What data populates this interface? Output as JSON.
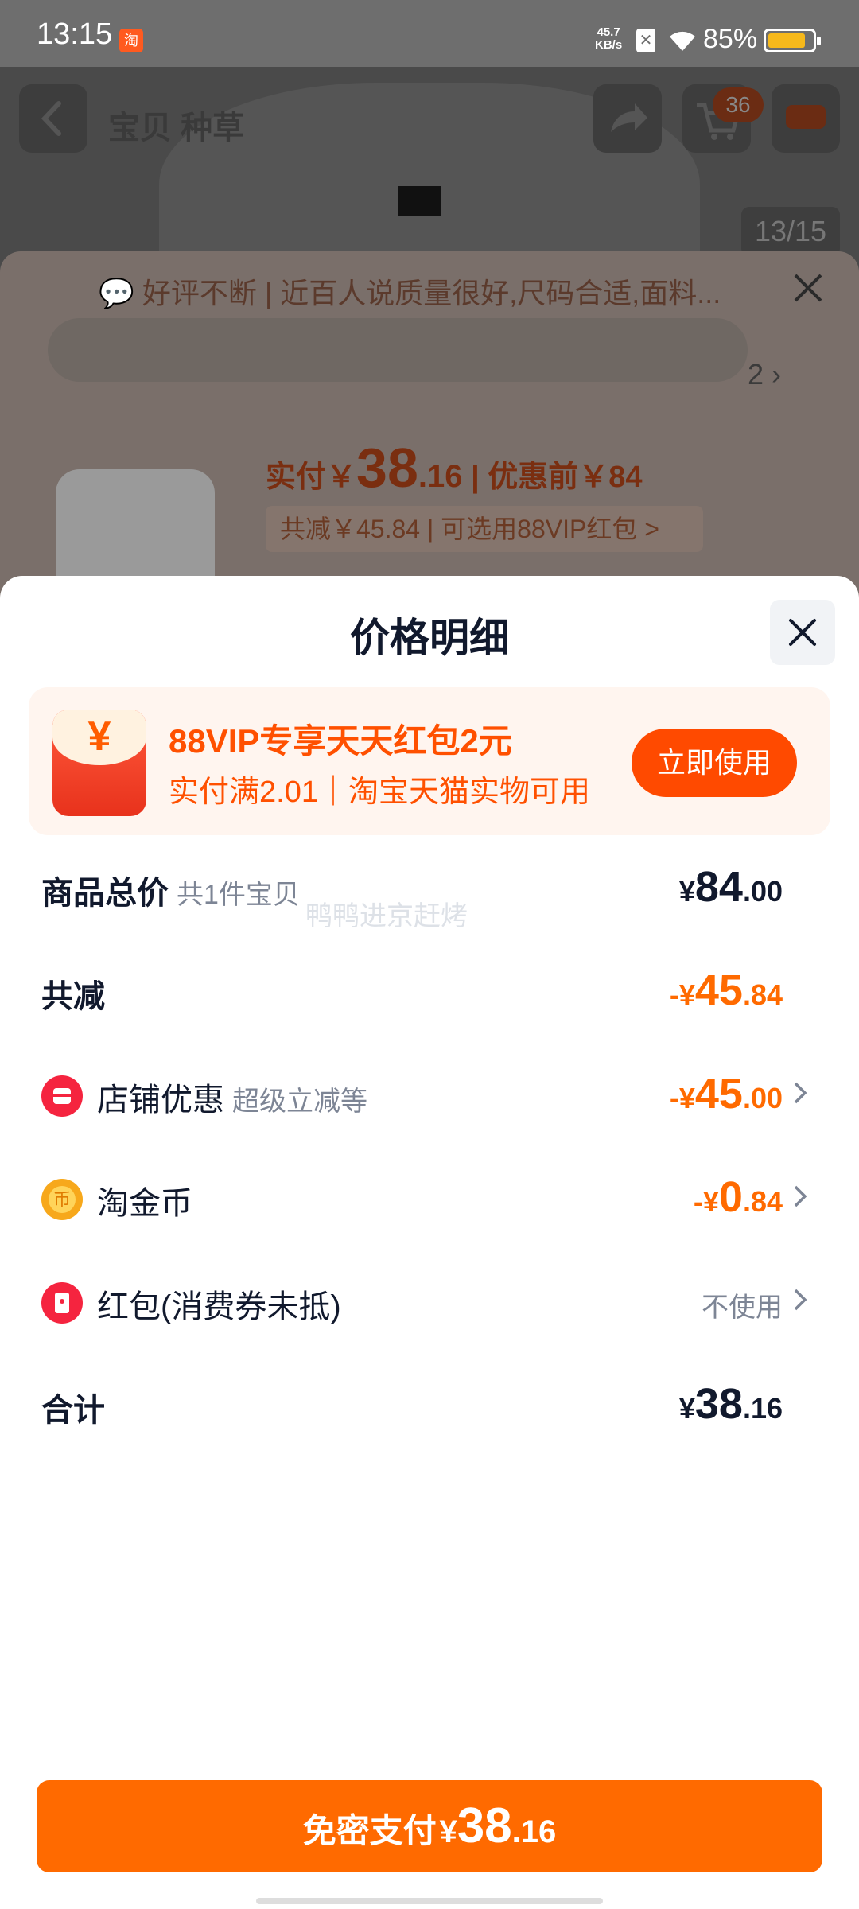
{
  "status_bar": {
    "time": "13:15",
    "notification_icon": "taobao-notification-icon",
    "net_speed_value": "45.7",
    "net_speed_unit": "KB/s",
    "battery_percent": "85%"
  },
  "background_page": {
    "tabs": "宝贝 种草",
    "image_counter": "13/15",
    "cart_badge": "36",
    "review_snippet": "好评不断 | 近百人说质量很好,尺码合适,面料...",
    "sku_count": "2",
    "price_prefix": "实付￥",
    "price_int": "38",
    "price_dec": ".16",
    "price_before": "| 优惠前￥84",
    "discount_line": "共减￥45.84 | 可选用88VIP红包 >"
  },
  "sheet": {
    "title": "价格明细",
    "promo": {
      "title": "88VIP专享天天红包2元",
      "subtitle": "实付满2.01｜淘宝天猫实物可用",
      "button": "立即使用",
      "icon": "red-envelope-icon"
    },
    "rows": {
      "total_price": {
        "label": "商品总价",
        "hint": "共1件宝贝",
        "currency": "¥",
        "int": "84",
        "dec": ".00"
      },
      "total_discount": {
        "label": "共减",
        "currency": "-¥",
        "int": "45",
        "dec": ".84"
      },
      "store_discount": {
        "label": "店铺优惠",
        "hint": "超级立减等",
        "currency": "-¥",
        "int": "45",
        "dec": ".00"
      },
      "taojinbi": {
        "label": "淘金币",
        "currency": "-¥",
        "int": "0",
        "dec": ".84"
      },
      "red_packet": {
        "label": "红包(消费券未抵)",
        "value": "不使用"
      },
      "total": {
        "label": "合计",
        "currency": "¥",
        "int": "38",
        "dec": ".16"
      }
    },
    "watermark": "鸭鸭进京赶烤"
  },
  "pay_button": {
    "label": "免密支付",
    "currency": "¥",
    "int": "38",
    "dec": ".16"
  },
  "colors": {
    "accent": "#ff6a00",
    "promo_bg": "#fff5ef",
    "text_dark": "#11192d",
    "text_muted": "#7d8595"
  }
}
